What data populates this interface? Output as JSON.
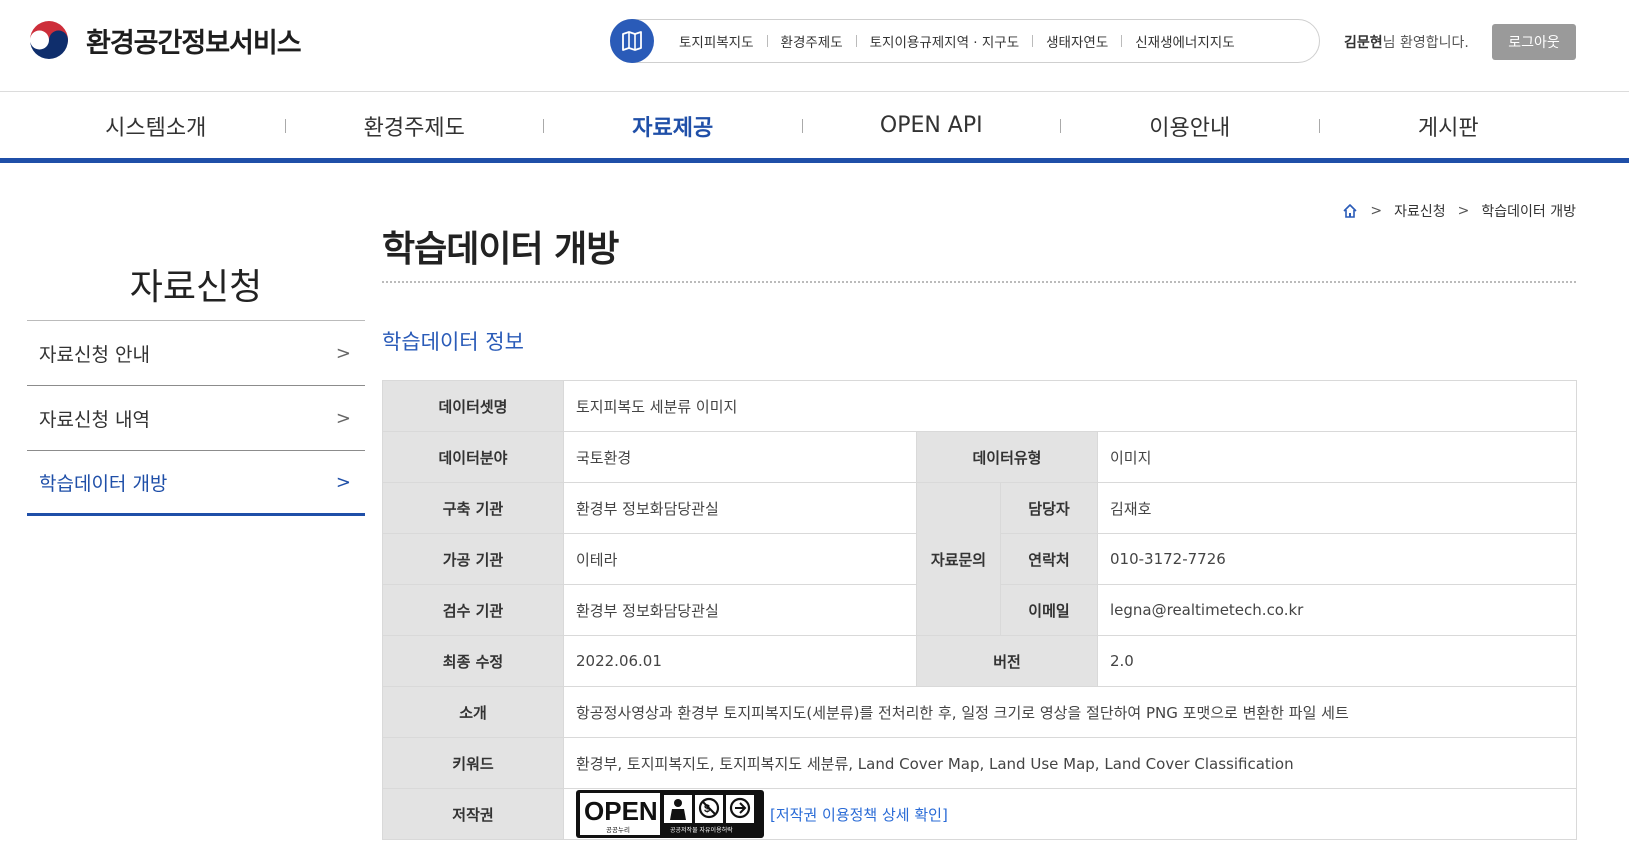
{
  "header": {
    "logo_text": "환경공간정보서비스",
    "quick_links": [
      "토지피복지도",
      "환경주제도",
      "토지이용규제지역 · 지구도",
      "생태자연도",
      "신재생에너지지도"
    ],
    "user_name": "김문현",
    "welcome_suffix": "님 환영합니다.",
    "logout_label": "로그아웃"
  },
  "gnb": {
    "items": [
      "시스템소개",
      "환경주제도",
      "자료제공",
      "OPEN API",
      "이용안내",
      "게시판"
    ],
    "active_index": 2
  },
  "sidebar": {
    "title": "자료신청",
    "items": [
      {
        "label": "자료신청 안내",
        "arrow": ">"
      },
      {
        "label": "자료신청 내역",
        "arrow": ">"
      },
      {
        "label": "학습데이터 개방",
        "arrow": ">"
      }
    ],
    "active_index": 2
  },
  "breadcrumb": {
    "sep": ">",
    "items": [
      "자료신청",
      "학습데이터 개방"
    ]
  },
  "page": {
    "title": "학습데이터 개방",
    "section_title": "학습데이터 정보"
  },
  "info": {
    "dataset_name_label": "데이터셋명",
    "dataset_name": "토지피복도 세분류 이미지",
    "field_label": "데이터분야",
    "field": "국토환경",
    "type_label": "데이터유형",
    "type": "이미지",
    "builder_label": "구축 기관",
    "builder": "환경부 정보화담당관실",
    "inquiry_label": "자료문의",
    "contact_person_label": "담당자",
    "contact_person": "김재호",
    "processor_label": "가공 기관",
    "processor": "이테라",
    "phone_label": "연락처",
    "phone": "010-3172-7726",
    "inspector_label": "검수 기관",
    "inspector": "환경부 정보화담당관실",
    "email_label": "이메일",
    "email": "legna@realtimetech.co.kr",
    "last_modified_label": "최종 수정",
    "last_modified": "2022.06.01",
    "version_label": "버전",
    "version": "2.0",
    "intro_label": "소개",
    "intro": "항공정사영상과 환경부 토지피복지도(세분류)를 전처리한 후, 일정 크기로 영상을 절단하여 PNG 포맷으로 변환한 파일 세트",
    "keywords_label": "키워드",
    "keywords": "환경부, 토지피복지도, 토지피복지도 세분류, Land Cover Map, Land Use Map, Land Cover Classification",
    "copyright_label": "저작권",
    "license_open": "OPEN",
    "license_nuri": "공공누리",
    "license_caption": "공공저작물 자유이용허락",
    "license_link": "[저작권 이용정책 상세 확인]"
  },
  "colors": {
    "brand_blue": "#1f4fa8",
    "link_blue": "#2a6bd6",
    "header_gray": "#e3e3e3"
  },
  "icons": [
    "map-book-icon",
    "home-icon",
    "chevron-right-icon",
    "government-emblem-icon"
  ]
}
